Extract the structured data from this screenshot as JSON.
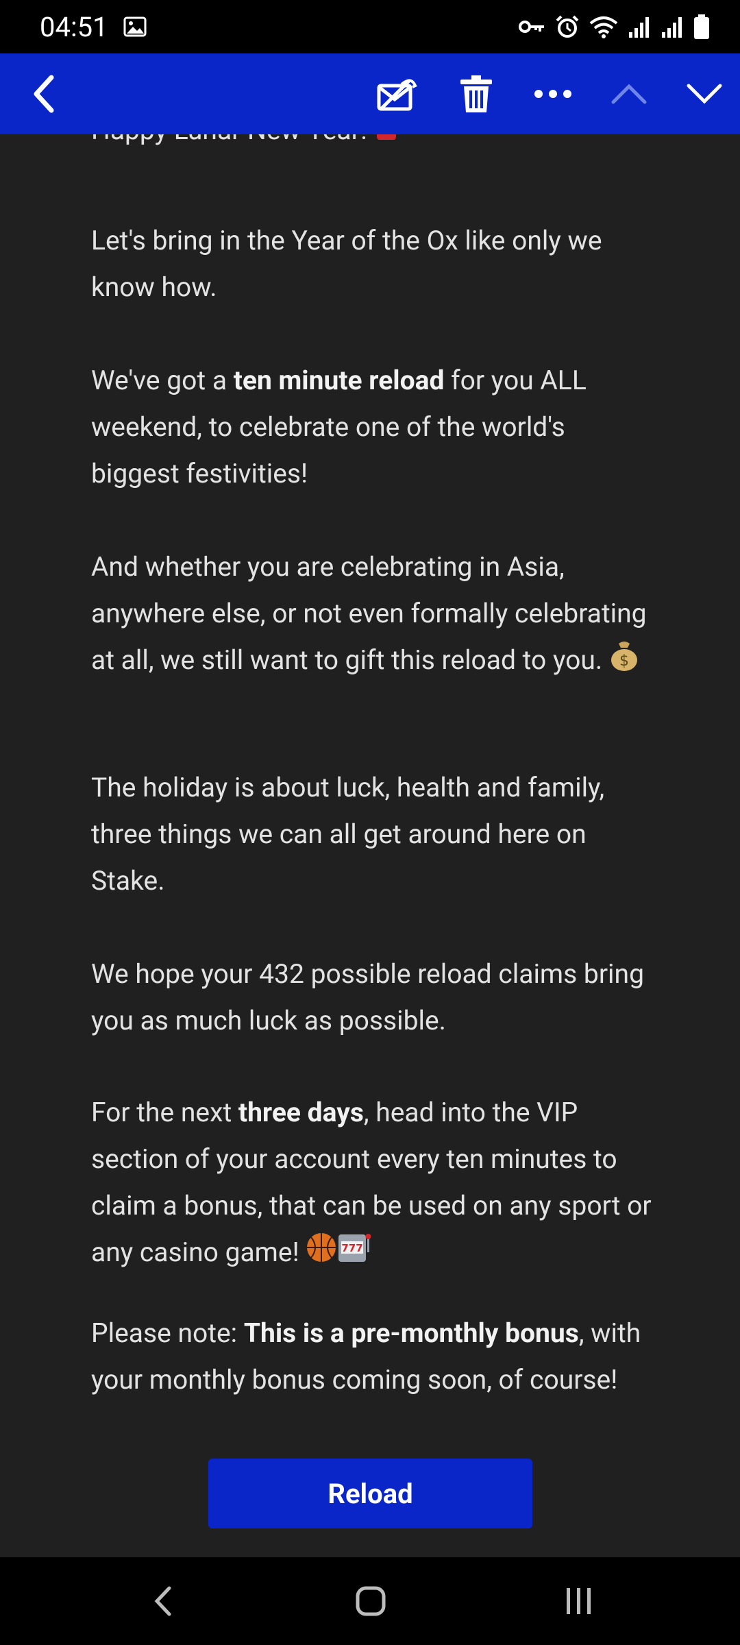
{
  "status_bar": {
    "time": "04:51"
  },
  "toolbar": {
    "back_icon": "back-arrow-icon",
    "mark_unread_icon": "mark-unread-icon",
    "delete_icon": "trash-icon",
    "more_icon": "more-dots-icon",
    "prev_icon": "chevron-up-icon",
    "next_icon": "chevron-down-icon"
  },
  "email": {
    "partial_greeting": "Happy Lunar New Year!",
    "p1": "Let's bring in the Year of the Ox like only we know how.",
    "p2_before": "We've got a ",
    "p2_bold": "ten minute reload",
    "p2_after": " for you ALL weekend, to celebrate one of the world's biggest festivities!",
    "p3": "And whether you are celebrating in Asia, anywhere else, or not even formally celebrating at all, we still want to gift this reload to you.",
    "p4": "The holiday is about luck, health and family, three things we can all get around here on Stake.",
    "p5": "We hope your 432 possible reload claims bring you as much luck as possible.",
    "p6_before": "For the next ",
    "p6_bold": "three days",
    "p6_after": ", head into the VIP section of your account every ten minutes to claim a bonus, that can be used on any sport or any casino game!",
    "p7_before": "Please note: ",
    "p7_bold": "This is a pre-monthly bonus",
    "p7_after": ", with your monthly bonus coming soon, of course!",
    "button_label": "Reload"
  },
  "colors": {
    "accent": "#0a25c8",
    "background": "#202020",
    "text": "#e3e3e3"
  }
}
